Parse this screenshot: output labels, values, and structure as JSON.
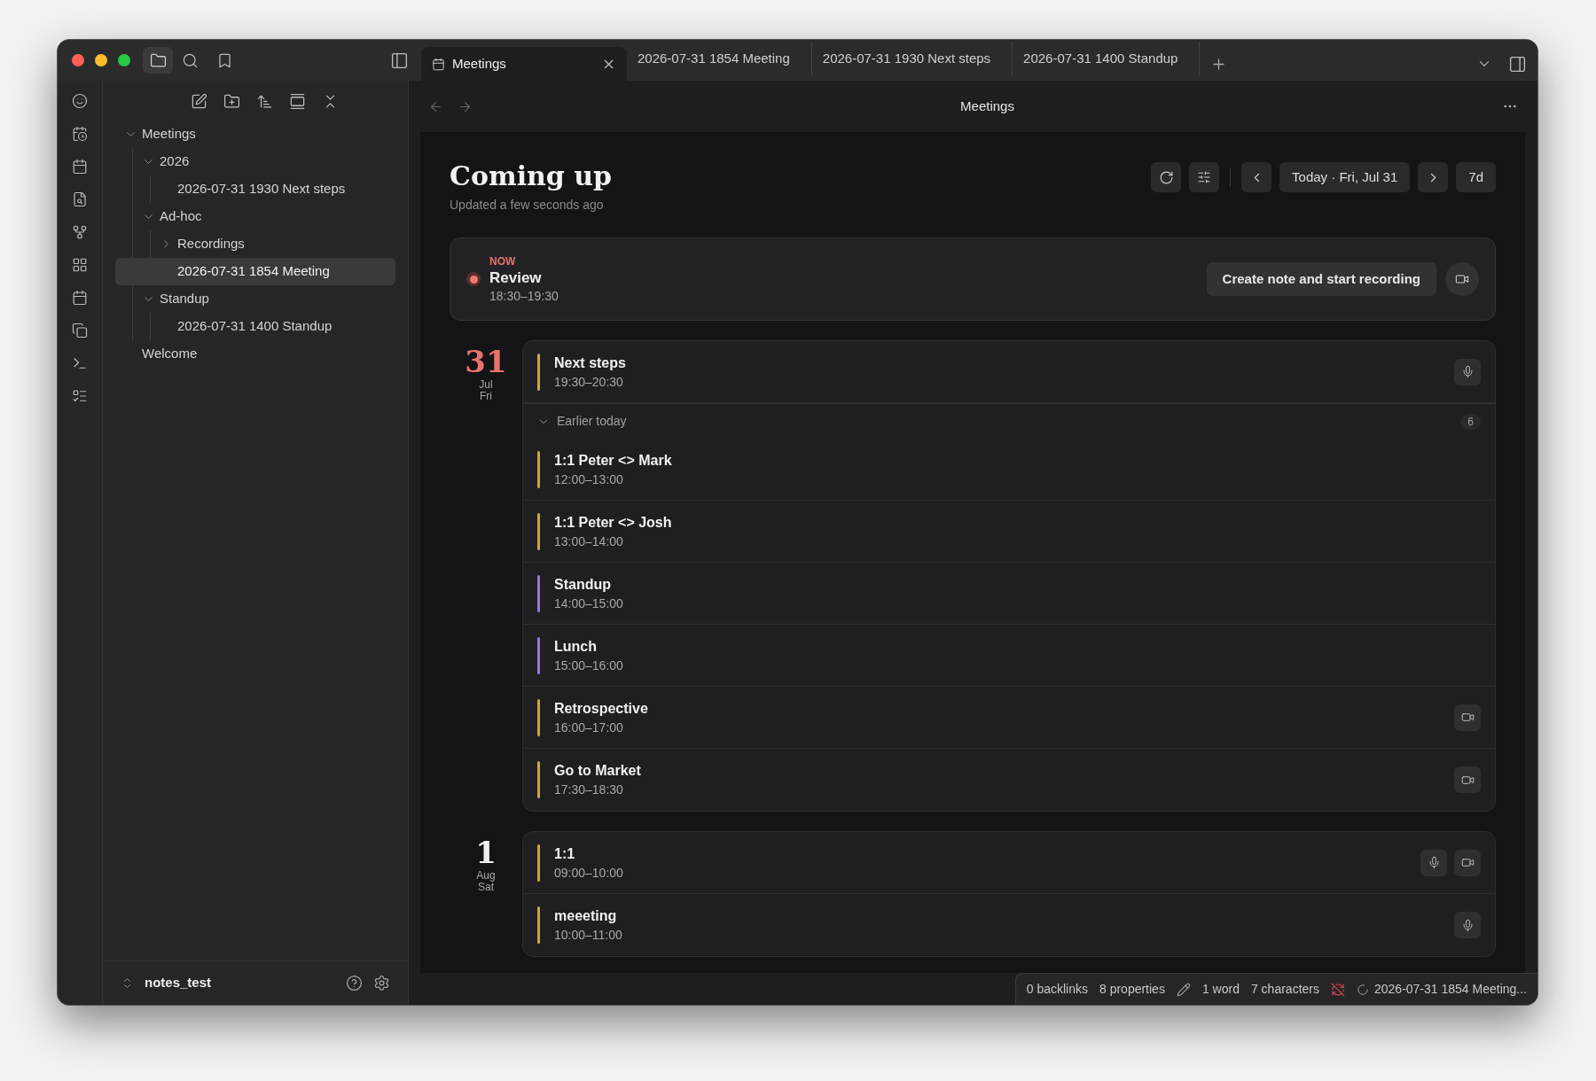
{
  "tabs": [
    {
      "label": "Meetings",
      "kind": "view",
      "selected": true
    },
    {
      "label": "2026-07-31 1854 Meeting",
      "kind": "note",
      "selected": false
    },
    {
      "label": "2026-07-31 1930 Next steps",
      "kind": "note",
      "selected": false
    },
    {
      "label": "2026-07-31 1400 Standup",
      "kind": "note",
      "selected": false
    }
  ],
  "sidebar": {
    "tree": [
      {
        "label": "Meetings",
        "kind": "folder",
        "expanded": true,
        "selected": false,
        "children": [
          {
            "label": "2026",
            "kind": "folder",
            "expanded": true,
            "selected": false,
            "children": [
              {
                "label": "2026-07-31 1930 Next steps",
                "kind": "file",
                "selected": false
              }
            ]
          },
          {
            "label": "Ad-hoc",
            "kind": "folder",
            "expanded": true,
            "selected": false,
            "children": [
              {
                "label": "Recordings",
                "kind": "folder",
                "expanded": false,
                "selected": false
              },
              {
                "label": "2026-07-31 1854 Meeting",
                "kind": "file",
                "selected": true
              }
            ]
          },
          {
            "label": "Standup",
            "kind": "folder",
            "expanded": true,
            "selected": false,
            "children": [
              {
                "label": "2026-07-31 1400 Standup",
                "kind": "file",
                "selected": false
              }
            ]
          }
        ]
      },
      {
        "label": "Welcome",
        "kind": "file",
        "selected": false
      }
    ],
    "vault": "notes_test"
  },
  "view": {
    "title": "Meetings",
    "heading": "Coming up",
    "updated": "Updated a few seconds ago",
    "date_button": "Today · Fri, Jul 31",
    "range_button": "7d",
    "now": {
      "label": "NOW",
      "title": "Review",
      "time": "18:30–19:30",
      "recording": true,
      "action": "Create note and start recording"
    },
    "days": [
      {
        "day": "31",
        "month": "Jul",
        "weekday": "Fri",
        "today": true,
        "events": [
          {
            "title": "Next steps",
            "time": "19:30–20:30",
            "color": "#d4a72c",
            "mic": true,
            "video": false
          }
        ],
        "earlier": {
          "label": "Earlier today",
          "count": "6",
          "expanded": true,
          "events": [
            {
              "title": "1:1 Peter <> Mark",
              "time": "12:00–13:00",
              "color": "#d4a72c",
              "mic": false,
              "video": false
            },
            {
              "title": "1:1 Peter <> Josh",
              "time": "13:00–14:00",
              "color": "#d4a72c",
              "mic": false,
              "video": false
            },
            {
              "title": "Standup",
              "time": "14:00–15:00",
              "color": "#9b72e0",
              "mic": false,
              "video": false
            },
            {
              "title": "Lunch",
              "time": "15:00–16:00",
              "color": "#9b72e0",
              "mic": false,
              "video": false
            },
            {
              "title": "Retrospective",
              "time": "16:00–17:00",
              "color": "#d4a72c",
              "mic": false,
              "video": true
            },
            {
              "title": "Go to Market",
              "time": "17:30–18:30",
              "color": "#d4a72c",
              "mic": false,
              "video": true
            }
          ]
        }
      },
      {
        "day": "1",
        "month": "Aug",
        "weekday": "Sat",
        "today": false,
        "events": [
          {
            "title": "1:1",
            "time": "09:00–10:00",
            "color": "#d4a72c",
            "mic": true,
            "video": true
          },
          {
            "title": "meeeting",
            "time": "10:00–11:00",
            "color": "#d4a72c",
            "mic": true,
            "video": false
          }
        ]
      }
    ]
  },
  "status_bar": {
    "items": [
      {
        "kind": "text",
        "text": "0 backlinks"
      },
      {
        "kind": "text",
        "text": "8 properties"
      },
      {
        "kind": "edit-icon"
      },
      {
        "kind": "text",
        "text": "1 word"
      },
      {
        "kind": "text",
        "text": "7 characters"
      },
      {
        "kind": "sync-off-icon"
      },
      {
        "kind": "loading",
        "text": "2026-07-31 1854 Meeting..."
      }
    ]
  }
}
